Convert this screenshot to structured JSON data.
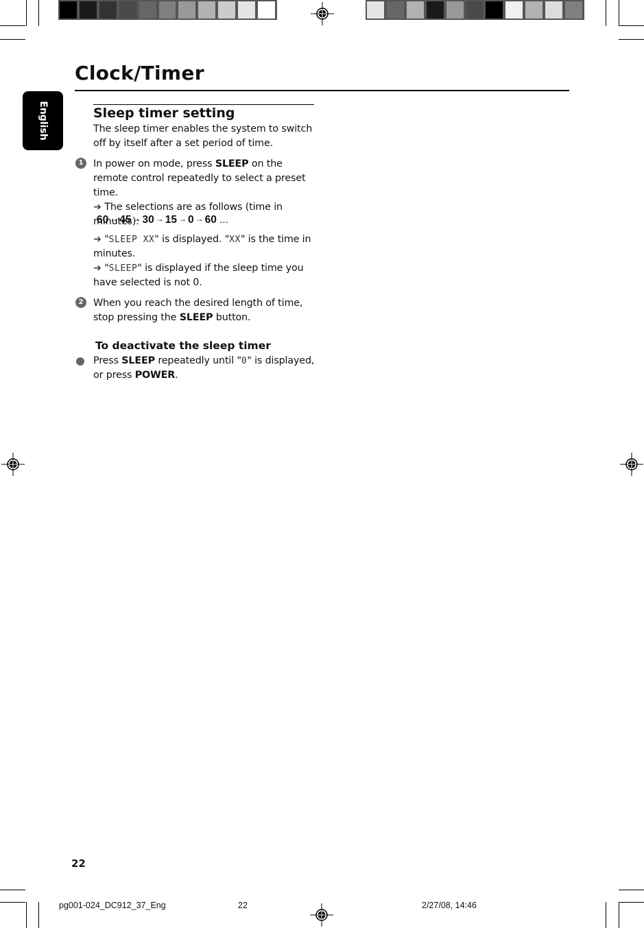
{
  "colors": {
    "left_swatches": [
      "#000000",
      "#1a1a1a",
      "#333333",
      "#4a4a4a",
      "#666666",
      "#7f7f7f",
      "#999999",
      "#b2b2b2",
      "#cccccc",
      "#e5e5e5",
      "#ffffff"
    ],
    "right_swatches": [
      "#e5e5e5",
      "#666666",
      "#b2b2b2",
      "#1a1a1a",
      "#999999",
      "#4a4a4a",
      "#000000",
      "#f0f0f0",
      "#b2b2b2",
      "#dcdcdc",
      "#7f7f7f"
    ],
    "step_badge": "#666666",
    "language_tab": "#000000"
  },
  "page": {
    "title": "Clock/Timer",
    "language_tab": "English",
    "page_number": "22"
  },
  "section": {
    "heading": "Sleep timer setting",
    "intro": "The sleep timer enables the system to switch off by itself after a set period of time.",
    "steps": [
      {
        "number": "1",
        "text_before": "In power on mode, press ",
        "bold": "SLEEP",
        "text_after": " on the remote control repeatedly to select a preset time.",
        "result_arrow": "➜",
        "result_text": " The selections are as follows (time in minutes):",
        "sequence": [
          "60",
          "45",
          "30",
          "15",
          "0",
          "60"
        ],
        "sequence_arrow": "→",
        "sequence_tail": " …",
        "notes": [
          {
            "arrow": "➜",
            "lcd1": "SLEEP XX",
            "text1": " is displayed. ",
            "lcd2": "XX",
            "text2": " is the time in minutes."
          },
          {
            "arrow": "➜",
            "lcd1": "SLEEP",
            "text1": " is displayed if the sleep time you have selected is not 0."
          }
        ]
      },
      {
        "number": "2",
        "text_before": "When you reach the desired length of time, stop pressing the ",
        "bold": "SLEEP",
        "text_after": " button."
      }
    ],
    "deactivate": {
      "heading": "To deactivate the sleep timer",
      "text_before": "Press ",
      "bold1": "SLEEP",
      "text_mid": " repeatedly until ",
      "lcd": "0",
      "text_mid2": " is displayed, or press ",
      "bold2": "POWER",
      "text_after": "."
    }
  },
  "footer": {
    "file": "pg001-024_DC912_37_Eng",
    "page": "22",
    "datetime": "2/27/08, 14:46"
  }
}
